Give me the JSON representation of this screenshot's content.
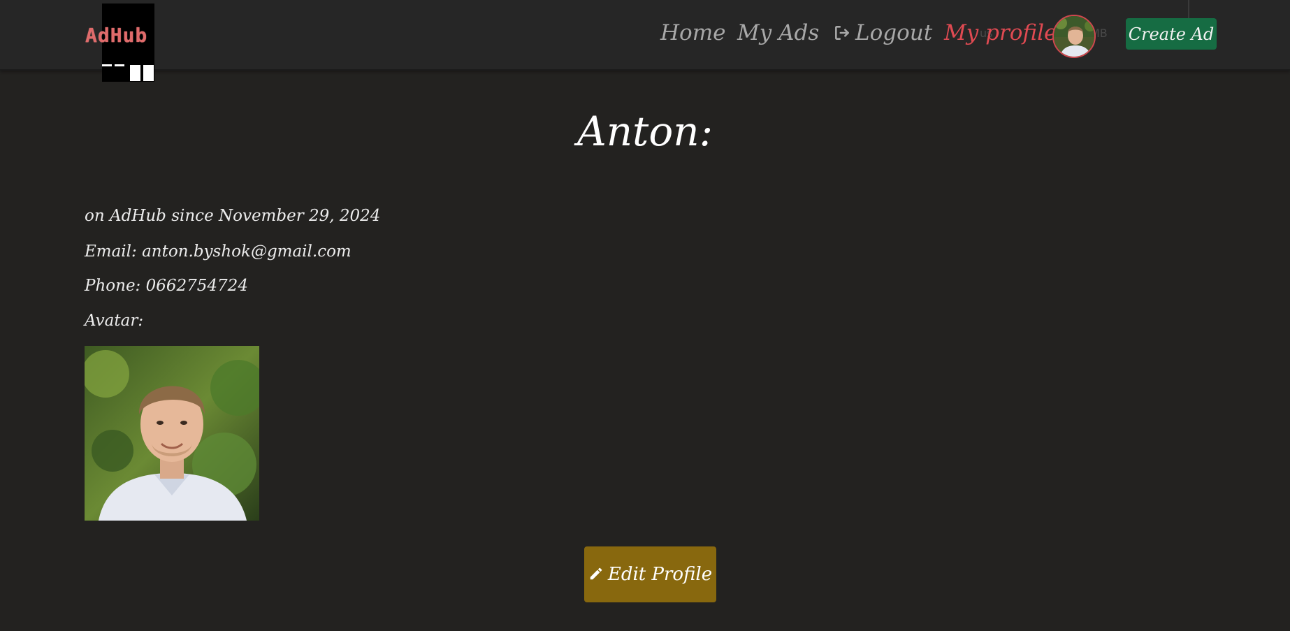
{
  "brand": {
    "name": "AdHub",
    "logo_color": "#e06b6b"
  },
  "nav": {
    "home_label": "Home",
    "my_ads_label": "My Ads",
    "logout_label": "Logout",
    "my_profile_label": "My profile",
    "create_ad_label": "Create Ad",
    "active_color": "#e04a52",
    "create_ad_color": "#166c43",
    "ghost_text_left": "us",
    "ghost_text_right": "MB"
  },
  "profile": {
    "title": "Anton:",
    "since": "on AdHub since November 29, 2024",
    "email": "Email: anton.byshok@gmail.com",
    "phone": "Phone: 0662754724",
    "avatar_label": "Avatar:",
    "edit_button_label": "Edit Profile",
    "edit_button_color": "#88680e"
  },
  "icons": {
    "logout": "logout-icon",
    "edit": "pencil-icon",
    "avatar": "avatar-photo"
  }
}
